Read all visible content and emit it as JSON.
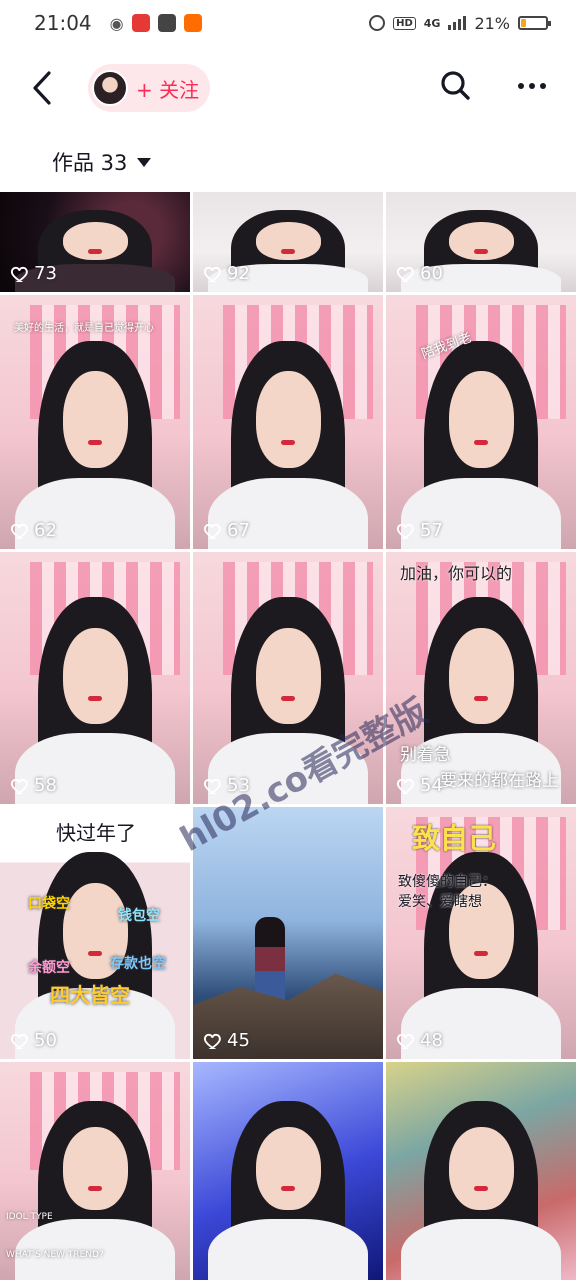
{
  "status_bar": {
    "time": "21:04",
    "network": "4G",
    "battery": "21%",
    "battery_level": 0.21,
    "hd_label": "HD"
  },
  "nav": {
    "follow_label": "+ 关注"
  },
  "works_tab": {
    "label": "作品 33"
  },
  "watermark": "hl02.co看完整版",
  "tiles": [
    {
      "likes": "73",
      "theme": "dark"
    },
    {
      "likes": "92",
      "theme": "light"
    },
    {
      "likes": "60",
      "theme": "light"
    },
    {
      "likes": "62",
      "theme": "pink",
      "caption": "美好的生活，就是自己觉得开心"
    },
    {
      "likes": "67",
      "theme": "pink"
    },
    {
      "likes": "57",
      "theme": "pink",
      "caption": "陪我到老"
    },
    {
      "likes": "58",
      "theme": "pink"
    },
    {
      "likes": "53",
      "theme": "pink"
    },
    {
      "likes": "54",
      "theme": "pink",
      "caption_top": "加油，你可以的",
      "caption_mid": "别着急",
      "caption_bottom": "要来的都在路上"
    },
    {
      "likes": "50",
      "theme": "white",
      "caption_top": "快过年了",
      "tags": [
        "口袋空",
        "钱包空",
        "余额空",
        "存款也空",
        "四大皆空"
      ]
    },
    {
      "likes": "45",
      "theme": "sky"
    },
    {
      "likes": "48",
      "theme": "pink",
      "caption_top": "致自己",
      "caption_sub": "致傻傻的自己：",
      "caption_sub2": "爱笑、爱瞎想"
    },
    {
      "likes": "",
      "theme": "pink",
      "caption": "IDOL TYPE",
      "caption2": "WHAT'S NEW TREND?"
    },
    {
      "likes": "",
      "theme": "blue"
    },
    {
      "likes": "",
      "theme": "warm"
    }
  ],
  "colors": {
    "accent": "#fe2c55",
    "follow_bg": "#fde7ea",
    "text": "#161823"
  }
}
